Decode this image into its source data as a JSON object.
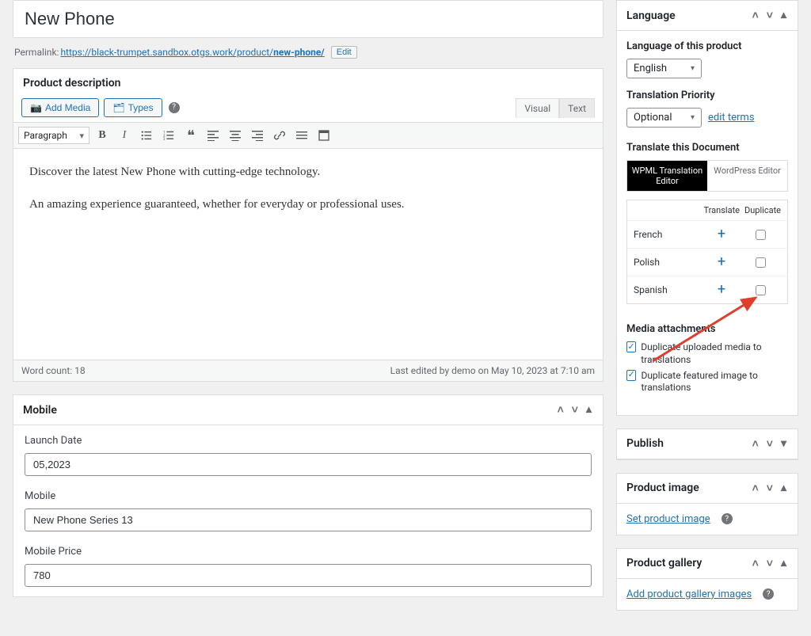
{
  "title": "New Phone",
  "permalink": {
    "label": "Permalink:",
    "base": "https://black-trumpet.sandbox.otgs.work/product/",
    "slug": "new-phone/",
    "edit": "Edit"
  },
  "description": {
    "header": "Product description",
    "addMedia": "Add Media",
    "types": "Types",
    "tabVisual": "Visual",
    "tabText": "Text",
    "formatSelect": "Paragraph",
    "content_p1": "Discover the latest New Phone with cutting-edge technology.",
    "content_p2": "An amazing experience guaranteed, whether for everyday or professional uses.",
    "wordCountLabel": "Word count: 18",
    "lastEdited": "Last edited by demo on May 10, 2023 at 7:10 am"
  },
  "mobilePanel": {
    "header": "Mobile",
    "launchDateLabel": "Launch Date",
    "launchDateValue": "05,2023",
    "mobileLabel": "Mobile",
    "mobileValue": "New Phone Series 13",
    "priceLabel": "Mobile Price",
    "priceValue": "780"
  },
  "language": {
    "header": "Language",
    "labelLangOfProduct": "Language of this product",
    "langValue": "English",
    "labelPriority": "Translation Priority",
    "priorityValue": "Optional",
    "editTerms": "edit terms",
    "labelTranslateDoc": "Translate this Document",
    "optWpml": "WPML Translation Editor",
    "optWp": "WordPress Editor",
    "colTranslate": "Translate",
    "colDuplicate": "Duplicate",
    "rows": [
      {
        "lang": "French"
      },
      {
        "lang": "Polish"
      },
      {
        "lang": "Spanish"
      }
    ],
    "mediaHeader": "Media attachments",
    "mediaOpt1": "Duplicate uploaded media to translations",
    "mediaOpt2": "Duplicate featured image to translations"
  },
  "publish": {
    "header": "Publish"
  },
  "productImage": {
    "header": "Product image",
    "link": "Set product image"
  },
  "productGallery": {
    "header": "Product gallery",
    "link": "Add product gallery images"
  }
}
